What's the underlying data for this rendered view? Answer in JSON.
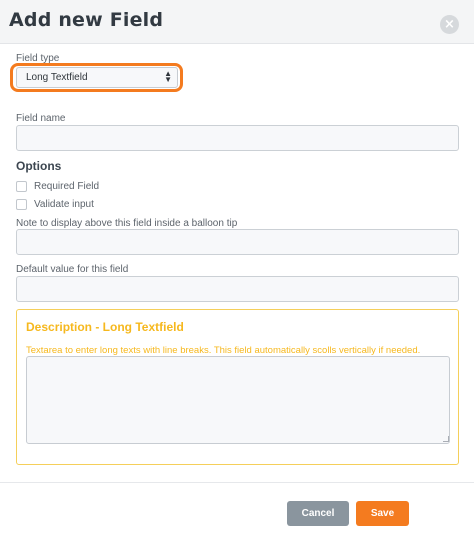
{
  "dialog": {
    "title": "Add new Field",
    "close_glyph": "×"
  },
  "field_type": {
    "label": "Field type",
    "selected": "Long Textfield"
  },
  "field_name": {
    "label": "Field name",
    "value": ""
  },
  "options": {
    "title": "Options",
    "required_label": "Required Field",
    "validate_label": "Validate input"
  },
  "note": {
    "label": "Note to display above this field inside a balloon tip",
    "value": ""
  },
  "default_value": {
    "label": "Default value for this field",
    "value": ""
  },
  "description": {
    "title": "Description - Long Textfield",
    "text": "Textarea to enter long texts with line breaks. This field automatically scolls vertically if needed."
  },
  "buttons": {
    "cancel": "Cancel",
    "save": "Save"
  },
  "colors": {
    "accent": "#f47b1f",
    "description": "#f6b81e",
    "cancel": "#8a959e"
  },
  "icons": {
    "close": "close-icon",
    "select_caret": "select-caret-icon"
  }
}
